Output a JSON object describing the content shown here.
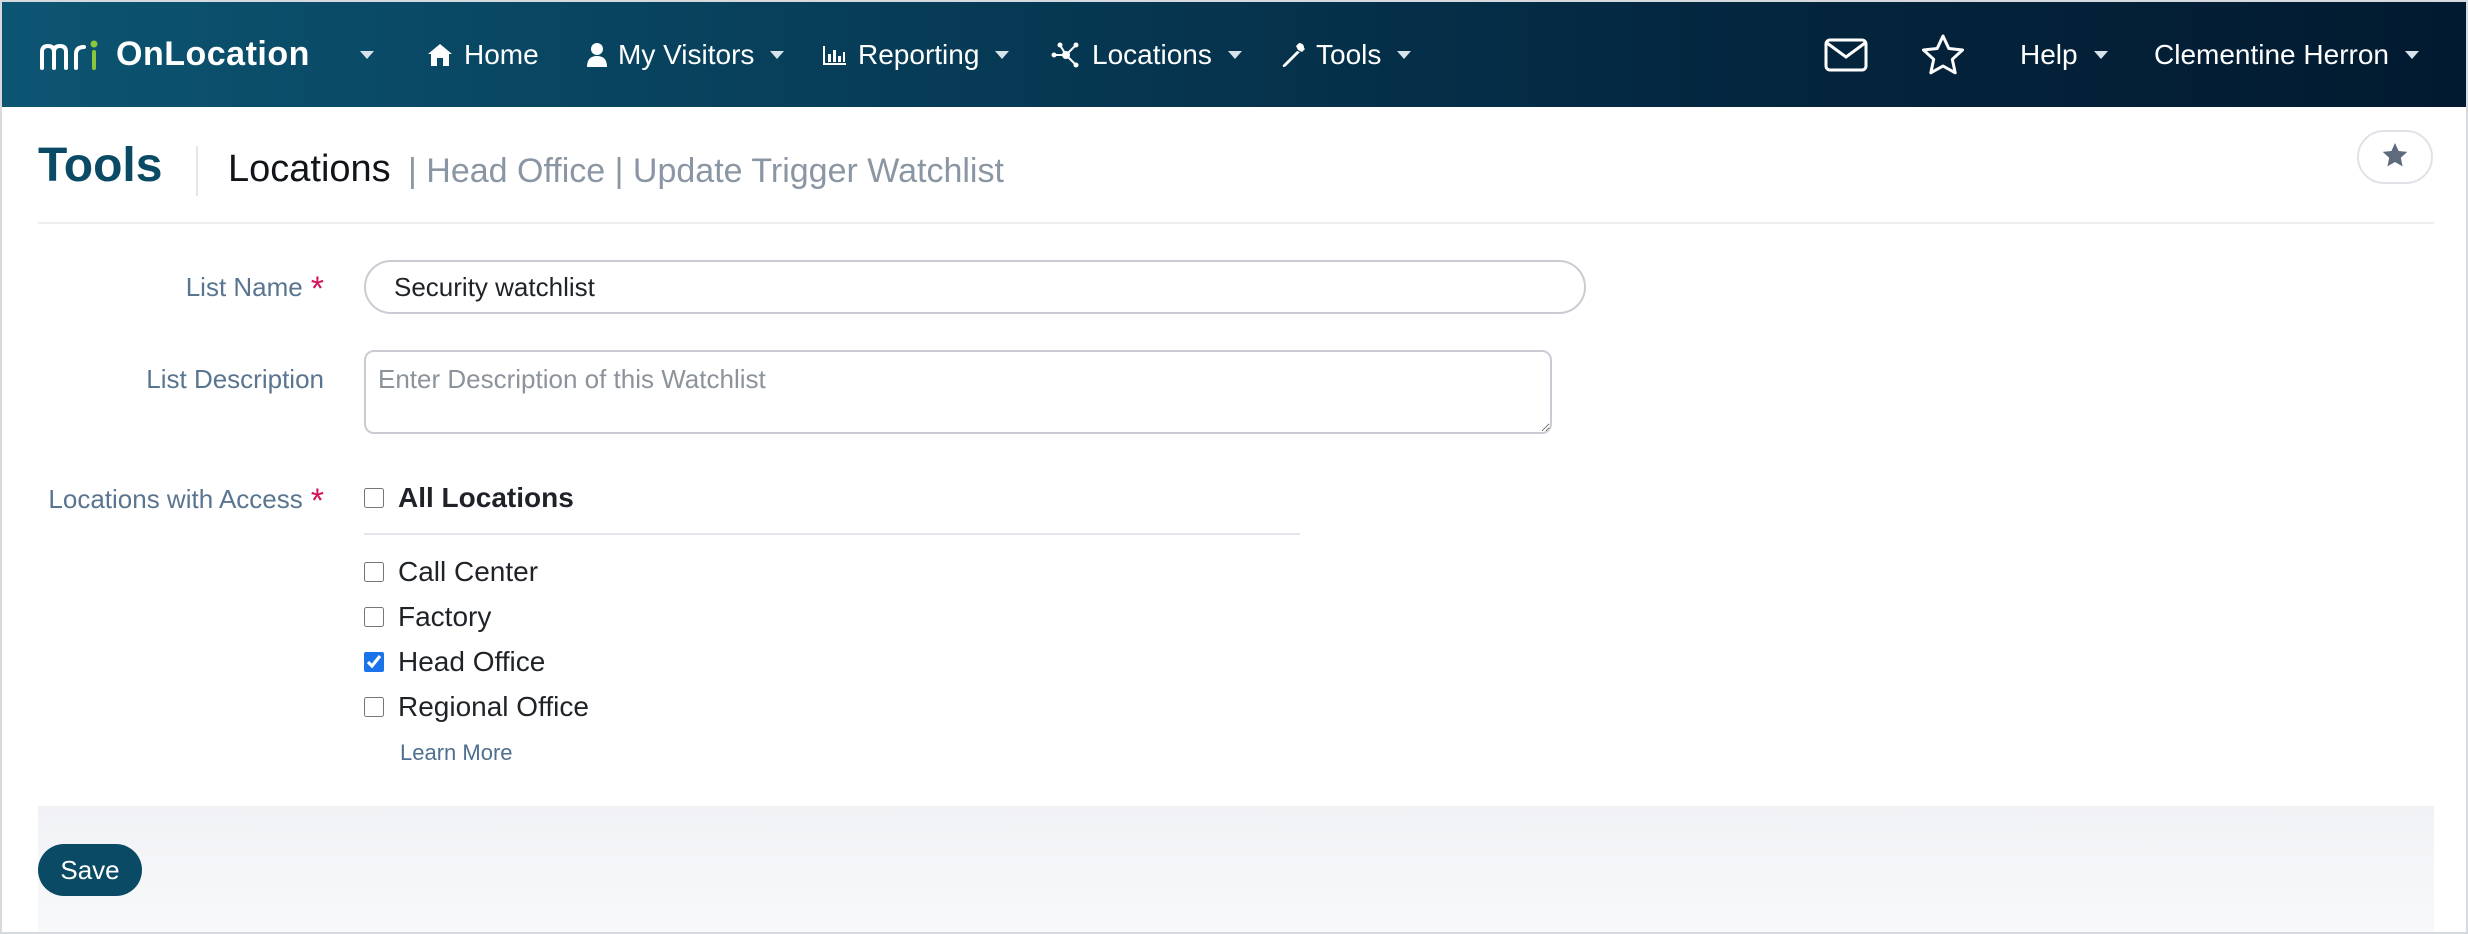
{
  "navbar": {
    "brand": {
      "logo_text": "mri",
      "name": "OnLocation"
    },
    "items": [
      {
        "label": "Home",
        "icon": "home-icon"
      },
      {
        "label": "My Visitors",
        "icon": "user-icon"
      },
      {
        "label": "Reporting",
        "icon": "bar-chart-icon"
      },
      {
        "label": "Locations",
        "icon": "network-icon"
      },
      {
        "label": "Tools",
        "icon": "wrench-icon"
      }
    ],
    "right": {
      "mail_icon": "envelope-icon",
      "favorite_icon": "star-outline-icon",
      "help_label": "Help",
      "user_label": "Clementine Herron"
    },
    "colors": {
      "gradient_start": "#0c5572",
      "gradient_end": "#021a30",
      "logo_accent": "#8cc63f"
    }
  },
  "header": {
    "section": "Tools",
    "current": "Locations",
    "trail": "| Head Office | Update Trigger Watchlist",
    "favorite_icon": "star-icon"
  },
  "form": {
    "list_name": {
      "label": "List Name",
      "required_mark": "*",
      "value": "Security watchlist"
    },
    "list_description": {
      "label": "List Description",
      "placeholder": "Enter Description of this Watchlist",
      "value": ""
    },
    "locations": {
      "label": "Locations with Access",
      "required_mark": "*",
      "all_label": "All Locations",
      "all_checked": false,
      "options": [
        {
          "label": "Call Center",
          "checked": false
        },
        {
          "label": "Factory",
          "checked": false
        },
        {
          "label": "Head Office",
          "checked": true
        },
        {
          "label": "Regional Office",
          "checked": false
        }
      ],
      "learn_more": "Learn More"
    }
  },
  "footer": {
    "save_label": "Save"
  },
  "colors": {
    "primary": "#0a4a64",
    "required": "#d0155a",
    "label": "#5a7590",
    "checkbox_accent": "#1a73e8"
  }
}
